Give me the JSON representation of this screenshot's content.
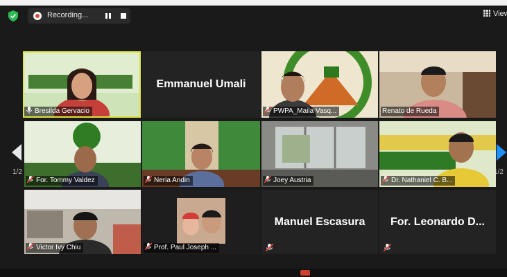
{
  "toolbar": {
    "recording_label": "Recording...",
    "view_label": "View"
  },
  "colors": {
    "active_speaker_outline": "#e0e33a",
    "recording_red": "#e0463a",
    "next_arrow": "#1e90ff",
    "security_shield": "#2dbb53"
  },
  "pagination": {
    "left_indicator": "1/2",
    "right_indicator": "1/2"
  },
  "participants": [
    {
      "name": "Bresilda Gervacio",
      "active": true,
      "muted": false,
      "video": true
    },
    {
      "name": "Emmanuel Umali",
      "video": false
    },
    {
      "name": "PWPA_Maila Vasq...",
      "muted": true,
      "video": true
    },
    {
      "name": "Renato de Rueda",
      "video": true
    },
    {
      "name": "For. Tommy Valdez",
      "muted": true,
      "video": true
    },
    {
      "name": "Neria Andin",
      "muted": true,
      "video": true
    },
    {
      "name": "Joey Austria",
      "muted": true,
      "video": true
    },
    {
      "name": "Dr. Nathaniel C. B...",
      "muted": true,
      "video": true
    },
    {
      "name": "Victor Ivy Chiu",
      "muted": true,
      "video": true
    },
    {
      "name": "Prof. Paul Joseph ...",
      "muted": true,
      "video": true
    },
    {
      "name": "Manuel Escasura",
      "muted": true,
      "video": false
    },
    {
      "name": "For. Leonardo D...",
      "muted": true,
      "video": false
    }
  ]
}
